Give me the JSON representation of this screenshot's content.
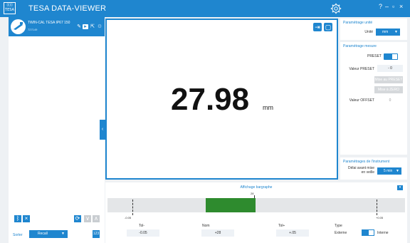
{
  "app": {
    "title": "TESA DATA-VIEWER",
    "logo_text": "TESA"
  },
  "window_controls": {
    "help": "?",
    "minimize": "–",
    "maximize": "▫",
    "close": "×"
  },
  "instrument": {
    "name": "TWIN-CAL TESA IP67 150",
    "serial": "727149"
  },
  "left_toolbar": {
    "bluetooth": "ᛒ",
    "remove": "×",
    "refresh": "⟳",
    "down": "∨",
    "up": "∧"
  },
  "sort": {
    "label": "Sorter",
    "selected": "Recall",
    "button": "123"
  },
  "display": {
    "value": "27.98",
    "unit": "mm"
  },
  "settings": {
    "unit_section": {
      "title": "Paramétrage unité",
      "unit_label": "Unité",
      "unit_value": "mm"
    },
    "measure_section": {
      "title": "Paramétrage mesure",
      "preset_label": "PRESET",
      "preset_value_label": "Valeur PRESET",
      "preset_value": "- 0",
      "set_preset_button": "Mise au PRESET",
      "set_zero_button": "Mise à ZERO",
      "offset_label": "Valeur OFFSET",
      "offset_value": "0"
    },
    "instrument_section": {
      "title": "Paramétrages de l'instrument",
      "sleep_label_line1": "Délai avant mise",
      "sleep_label_line2": "en veille",
      "sleep_value": "5 min"
    }
  },
  "bargraph": {
    "title": "Affichage bargraphe",
    "nominal_tick": "28",
    "lower_tick": "-0.05",
    "upper_tick": "+0.05",
    "tol_minus_label": "Tol-",
    "nom_label": "Nom",
    "tol_plus_label": "Tol+",
    "type_label": "Type",
    "tol_minus_value": "-0.05",
    "nom_value": "+28",
    "tol_plus_value": "+.05",
    "external_label": "Externe",
    "internal_label": "Interne",
    "fill_start_fraction": 0.329,
    "fill_end_fraction": 0.498
  }
}
